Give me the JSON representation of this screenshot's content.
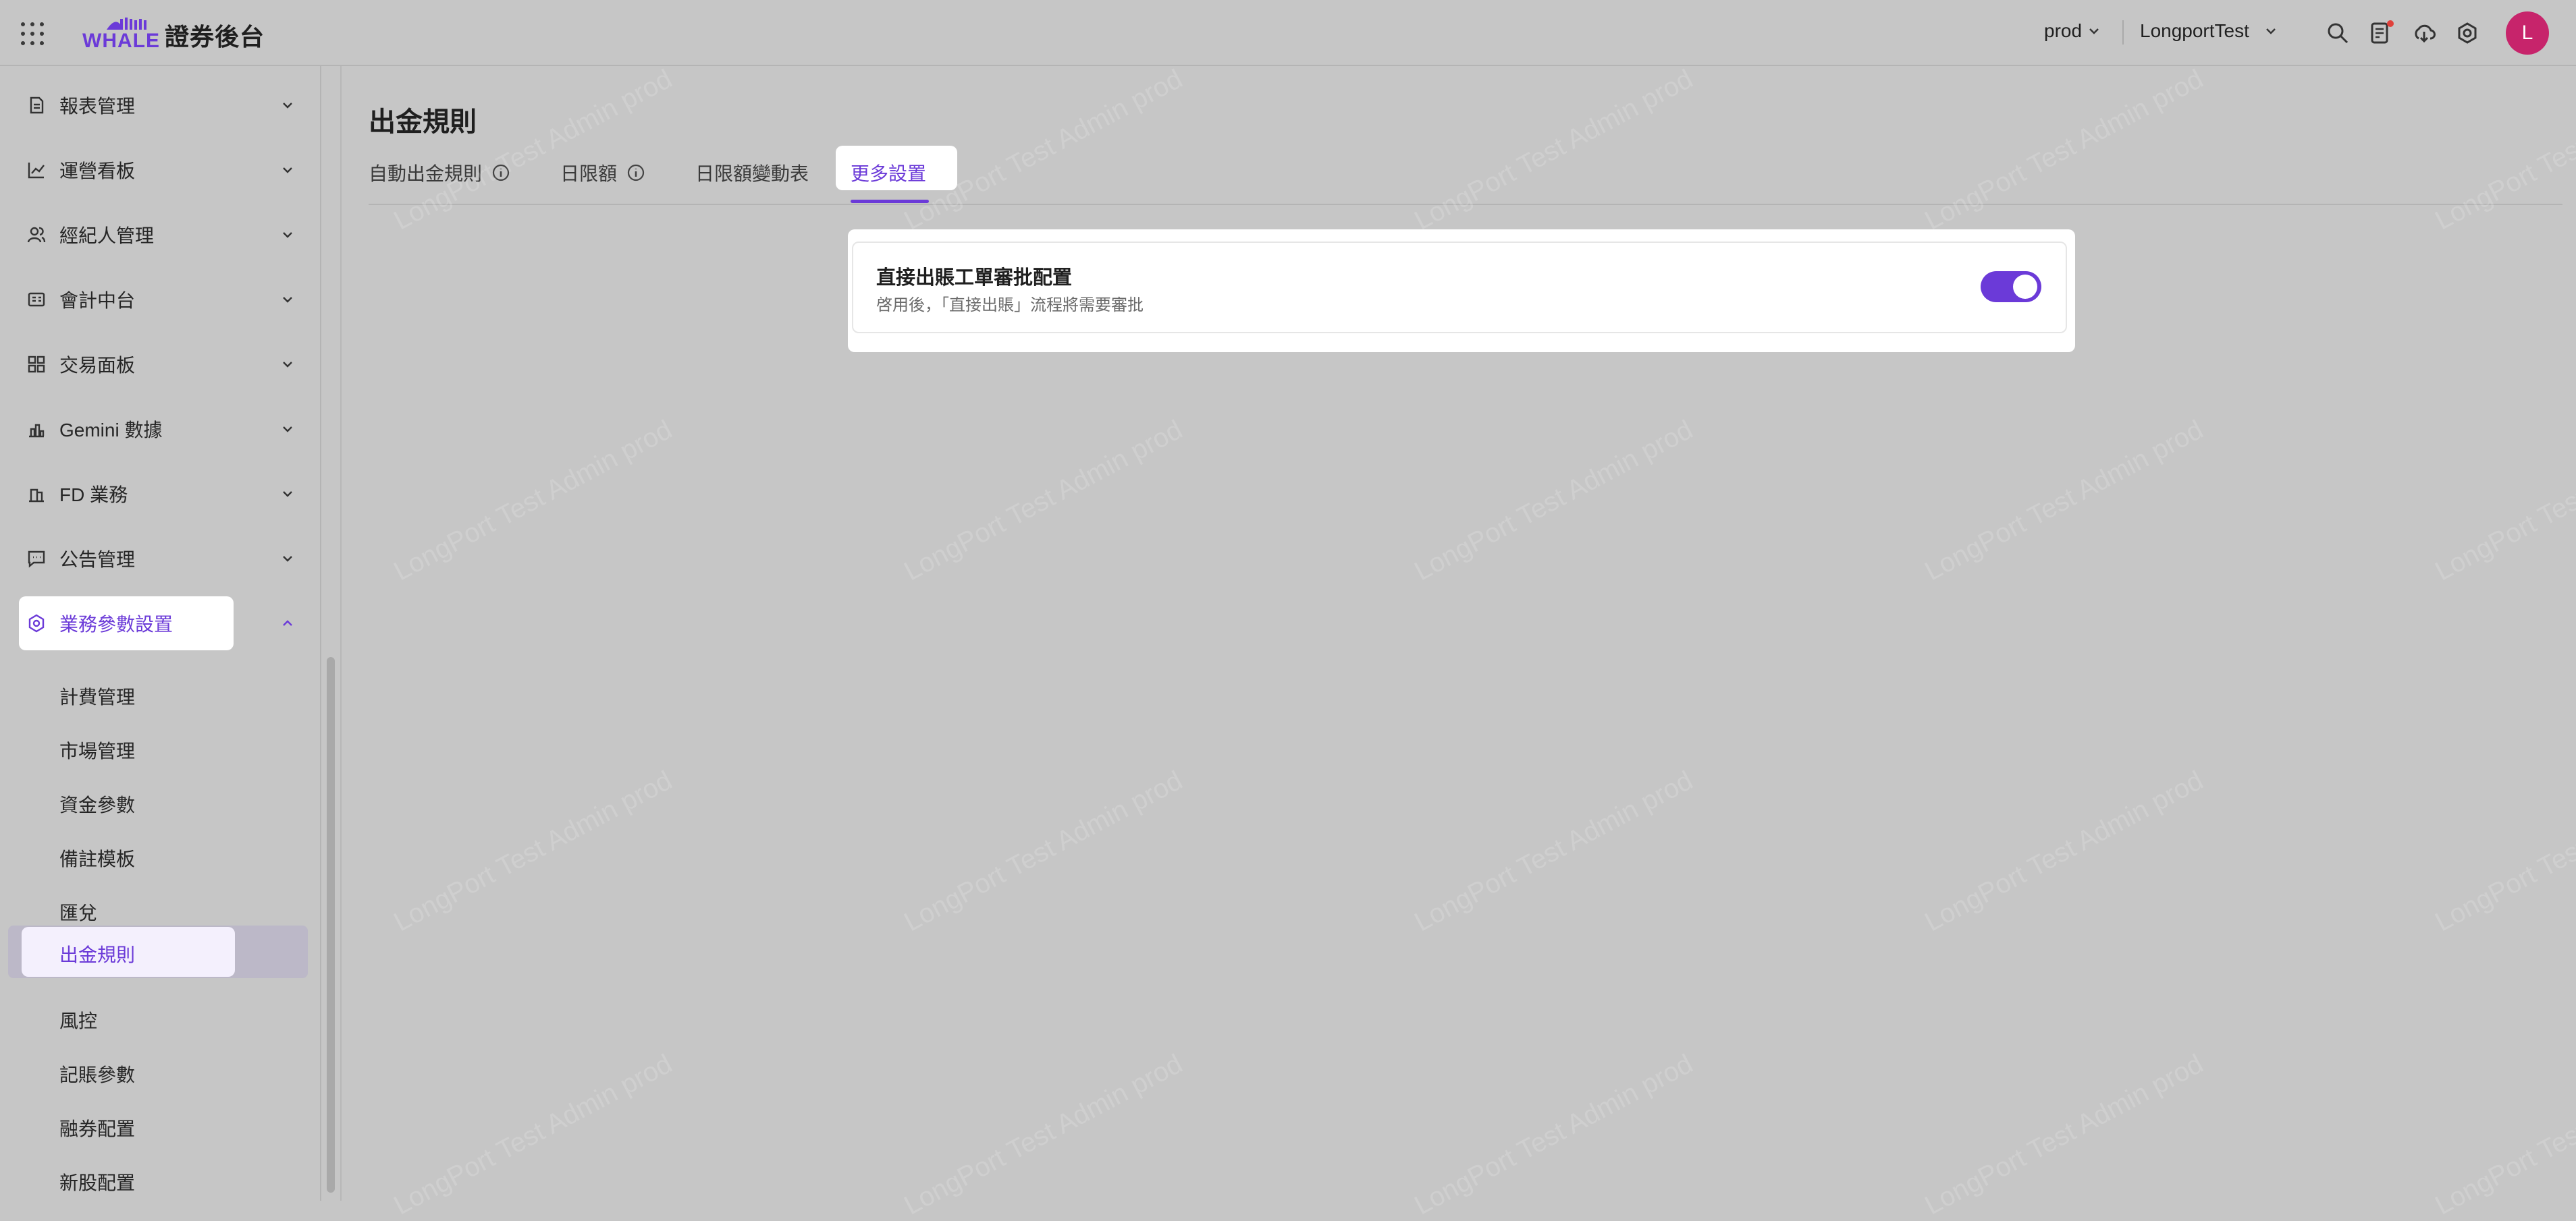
{
  "header": {
    "brand_logo_text": "WHALE",
    "brand_title": "證券後台",
    "env_select": "prod",
    "account_select": "LongportTest",
    "avatar_initial": "L"
  },
  "sidebar": {
    "items": [
      {
        "label": "報表管理",
        "icon": "report-icon"
      },
      {
        "label": "運營看板",
        "icon": "line-chart-icon"
      },
      {
        "label": "經紀人管理",
        "icon": "users-icon"
      },
      {
        "label": "會計中台",
        "icon": "ledger-icon"
      },
      {
        "label": "交易面板",
        "icon": "dashboard-icon"
      },
      {
        "label": "Gemini 數據",
        "icon": "bar-chart-icon"
      },
      {
        "label": "FD 業務",
        "icon": "bank-icon"
      },
      {
        "label": "公告管理",
        "icon": "message-icon"
      },
      {
        "label": "業務參數設置",
        "icon": "gear-icon"
      }
    ],
    "sub_items": [
      "計費管理",
      "市場管理",
      "資金參數",
      "備註模板",
      "匯兌",
      "出金規則",
      "風控",
      "記賬參數",
      "融券配置",
      "新股配置"
    ]
  },
  "main": {
    "page_title": "出金規則",
    "tabs": [
      {
        "label": "自動出金規則"
      },
      {
        "label": "日限額"
      },
      {
        "label": "日限額變動表"
      },
      {
        "label": "更多設置"
      }
    ],
    "setting": {
      "title": "直接出賬工單審批配置",
      "description": "啓用後，「直接出賬」流程將需要審批",
      "enabled": true
    }
  },
  "watermark": "LongPort Test Admin prod",
  "colors": {
    "accent": "#6b3ad8",
    "avatar": "#c7246b",
    "overlay": "#c6c6c6"
  }
}
